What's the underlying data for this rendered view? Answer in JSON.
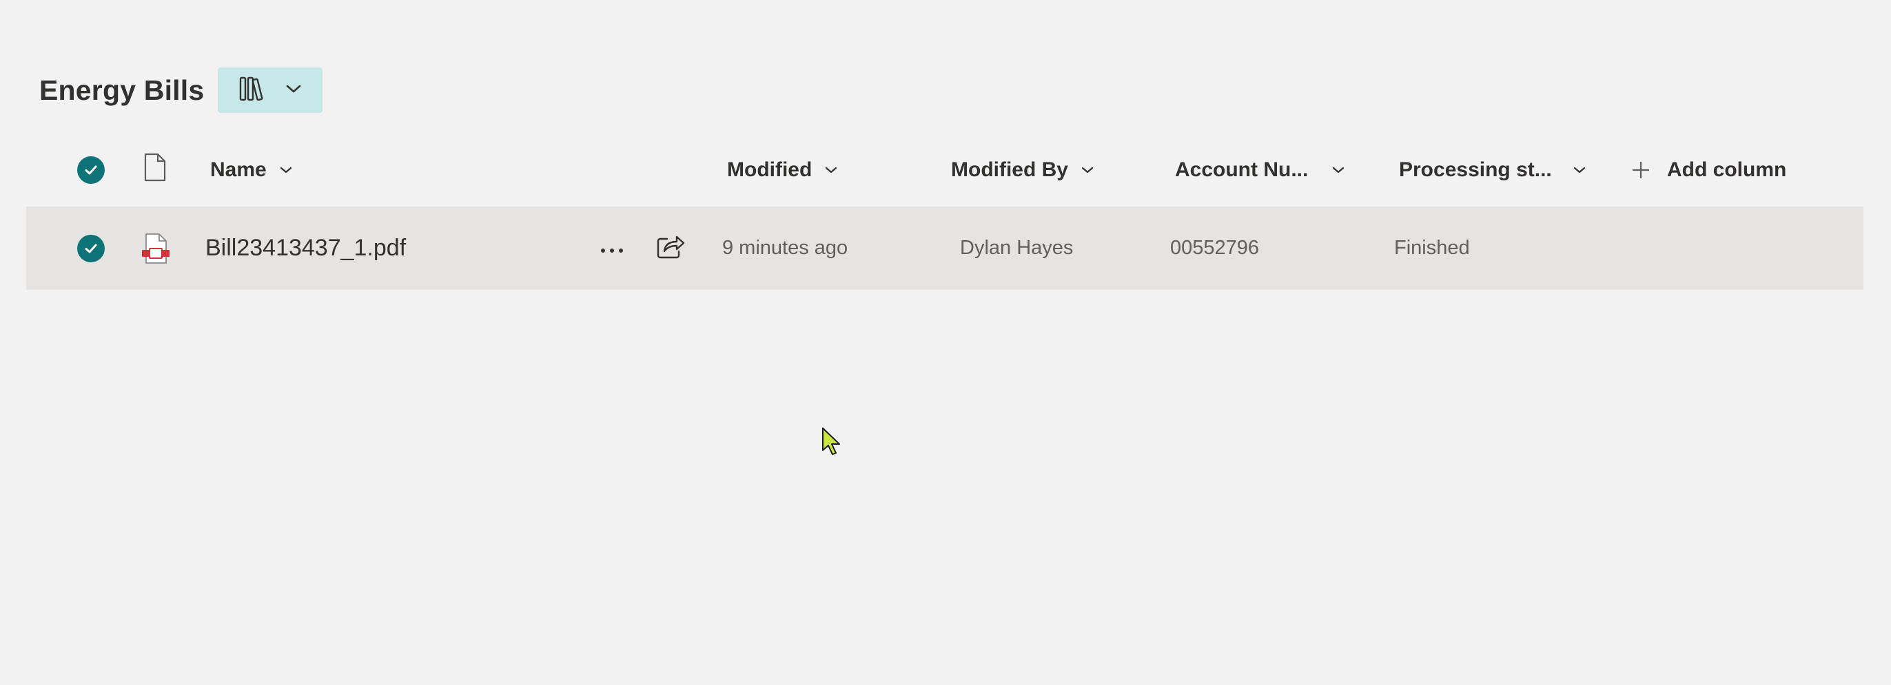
{
  "library": {
    "title": "Energy Bills",
    "view_switcher_icon": "library-books-icon"
  },
  "columns": {
    "name": "Name",
    "modified": "Modified",
    "modified_by": "Modified By",
    "account_number": "Account Nu...",
    "processing_status": "Processing st...",
    "add_column": "Add column"
  },
  "rows": [
    {
      "selected": true,
      "file_icon": "pdf-file-icon",
      "name": "Bill23413437_1.pdf",
      "modified": "9 minutes ago",
      "modified_by": "Dylan Hayes",
      "account_number": "00552796",
      "processing_status": "Finished"
    }
  ],
  "colors": {
    "accent": "#0d7377",
    "view_button_bg": "#c6e8e8",
    "selected_row_bg": "#e6e4e3",
    "pdf_red": "#d13438",
    "cursor": "#c8e63c"
  }
}
